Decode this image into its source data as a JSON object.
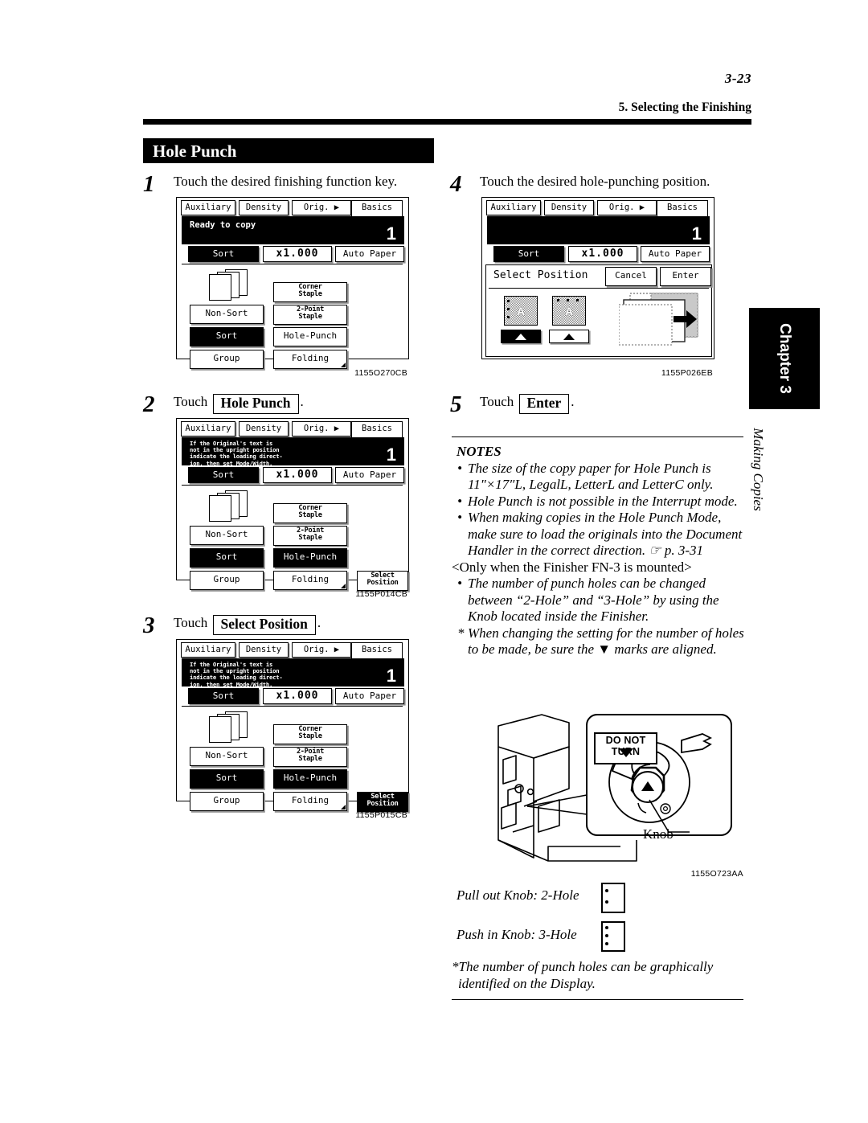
{
  "header": {
    "folio": "3-23",
    "running_head": "5. Selecting the Finishing"
  },
  "section": {
    "title": "Hole Punch"
  },
  "chapter_tab": {
    "label": "Chapter 3",
    "subtitle": "Making Copies"
  },
  "steps": [
    {
      "num": "1",
      "text": "Touch the desired finishing function key."
    },
    {
      "num": "2",
      "prefix": "Touch",
      "key": "Hole Punch",
      "suffix": "."
    },
    {
      "num": "3",
      "prefix": "Touch",
      "key": "Select Position",
      "suffix": "."
    },
    {
      "num": "4",
      "text": "Touch the desired hole-punching position."
    },
    {
      "num": "5",
      "prefix": "Touch",
      "key": "Enter",
      "suffix": "."
    }
  ],
  "lcd_common": {
    "tabs": [
      "Auxiliary",
      "Density",
      "Orig. ▶ Copy",
      "Basics"
    ],
    "active_tab": "Basics",
    "copy_count": "1",
    "mode_sort": "Sort",
    "mode_zoom": "x1.000",
    "mode_paper": "Auto Paper",
    "finishing": {
      "non_sort": "Non-Sort",
      "sort": "Sort",
      "group": "Group",
      "corner_staple_l1": "Corner",
      "corner_staple_l2": "Staple",
      "two_point_l1": "2-Point",
      "two_point_l2": "Staple",
      "hole_punch": "Hole-Punch",
      "folding": "Folding",
      "select_position_l1": "Select",
      "select_position_l2": "Position"
    }
  },
  "panel1": {
    "figcode": "1155O270CB",
    "status": "Ready to copy",
    "selected": [
      "Sort"
    ],
    "has_select_position": false
  },
  "panel2": {
    "figcode": "1155P014CB",
    "status_lines": "If the Original's text is\nnot in the upright position\nindicate the loading direct-\nion, then set Mode/Width.",
    "selected": [
      "Sort",
      "Hole-Punch"
    ],
    "has_select_position": true,
    "select_position_selected": false
  },
  "panel3": {
    "figcode": "1155P015CB",
    "status_lines": "If the Original's text is\nnot in the upright position\nindicate the loading direct-\nion, then set Mode/Width.",
    "selected": [
      "Sort",
      "Hole-Punch",
      "Select Position"
    ],
    "has_select_position": true,
    "select_position_selected": true
  },
  "panel4": {
    "figcode": "1155P026EB",
    "status": "",
    "dialog": {
      "title": "Select Position",
      "cancel": "Cancel",
      "enter": "Enter",
      "position_left_label": "A",
      "position_top_label": "A",
      "left_selected": true
    }
  },
  "notes": {
    "heading": "NOTES",
    "items": [
      "The size of the copy paper for Hole Punch is 11″×17″L, LegalL, LetterL and LetterC only.",
      "Hole Punch is not possible in the Interrupt mode.",
      "When making copies in the Hole Punch Mode, make sure to load the originals into the Document Handler in the correct direction. ☞ p. 3-31"
    ],
    "condition": "<Only when the Finisher FN-3 is mounted>",
    "items2": [
      "The number of punch holes can be changed between “2-Hole” and “3-Hole” by using the Knob located inside the Finisher.",
      "When changing the setting for the number of holes to be made, be sure the ▼ marks are aligned."
    ]
  },
  "knob_figure": {
    "do_not_turn": "DO NOT TURN",
    "knob_label": "Knob",
    "figcode": "1155O723AA"
  },
  "legend": {
    "row1": "Pull out Knob: 2-Hole",
    "row2": "Push in Knob: 3-Hole",
    "footnote": "*The number of punch holes can be graphically identified on the Display."
  }
}
